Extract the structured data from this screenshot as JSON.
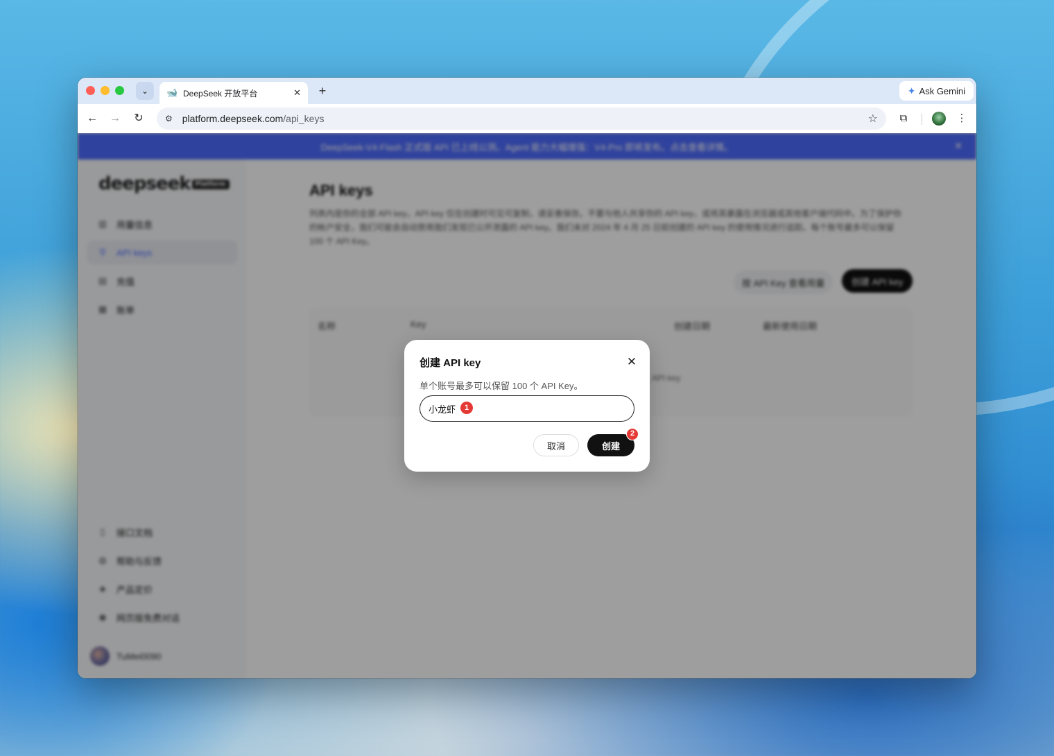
{
  "browser": {
    "tab_title": "DeepSeek 开放平台",
    "url_host": "platform.deepseek.com",
    "url_path": "/api_keys",
    "ask_gemini": "Ask Gemini"
  },
  "page": {
    "banner": "DeepSeek-V4-Flash 正式版 API 已上线公测。Agent 能力大幅增强：V4-Pro 即将发布。点击查看详情。",
    "logo": "deepseek",
    "logo_badge": "Platform",
    "sidebar": {
      "items": [
        {
          "label": "用量信息"
        },
        {
          "label": "API keys"
        },
        {
          "label": "充值"
        },
        {
          "label": "账单"
        }
      ],
      "bottom_items": [
        {
          "label": "接口文档"
        },
        {
          "label": "帮助与反馈"
        },
        {
          "label": "产品定价"
        },
        {
          "label": "网页版免费对话"
        }
      ],
      "user": "TuMei0090"
    },
    "title": "API keys",
    "description": "列表内是你的全部 API key，API key 仅在创建时可见可复制，请妥善保存。不要与他人共享你的 API key，或将其暴露在浏览器或其他客户端代码中。为了保护你的帐户安全，我们可能会自动禁用我们发现已公开泄露的 API key。我们未对 2024 年 4 月 25 日前创建的 API key 的使用情况进行追踪。每个账号最多可以保留 100 个 API Key。",
    "usage_button": "按 API Key 查看用量",
    "create_button": "创建 API key",
    "table_headers": [
      "名称",
      "Key",
      "创建日期",
      "最新使用日期"
    ],
    "table_empty": "API key"
  },
  "modal": {
    "title": "创建 API key",
    "description": "单个账号最多可以保留 100 个 API Key。",
    "input_value": "小龙虾",
    "step1": "1",
    "step2": "2",
    "cancel": "取消",
    "create": "创建"
  }
}
